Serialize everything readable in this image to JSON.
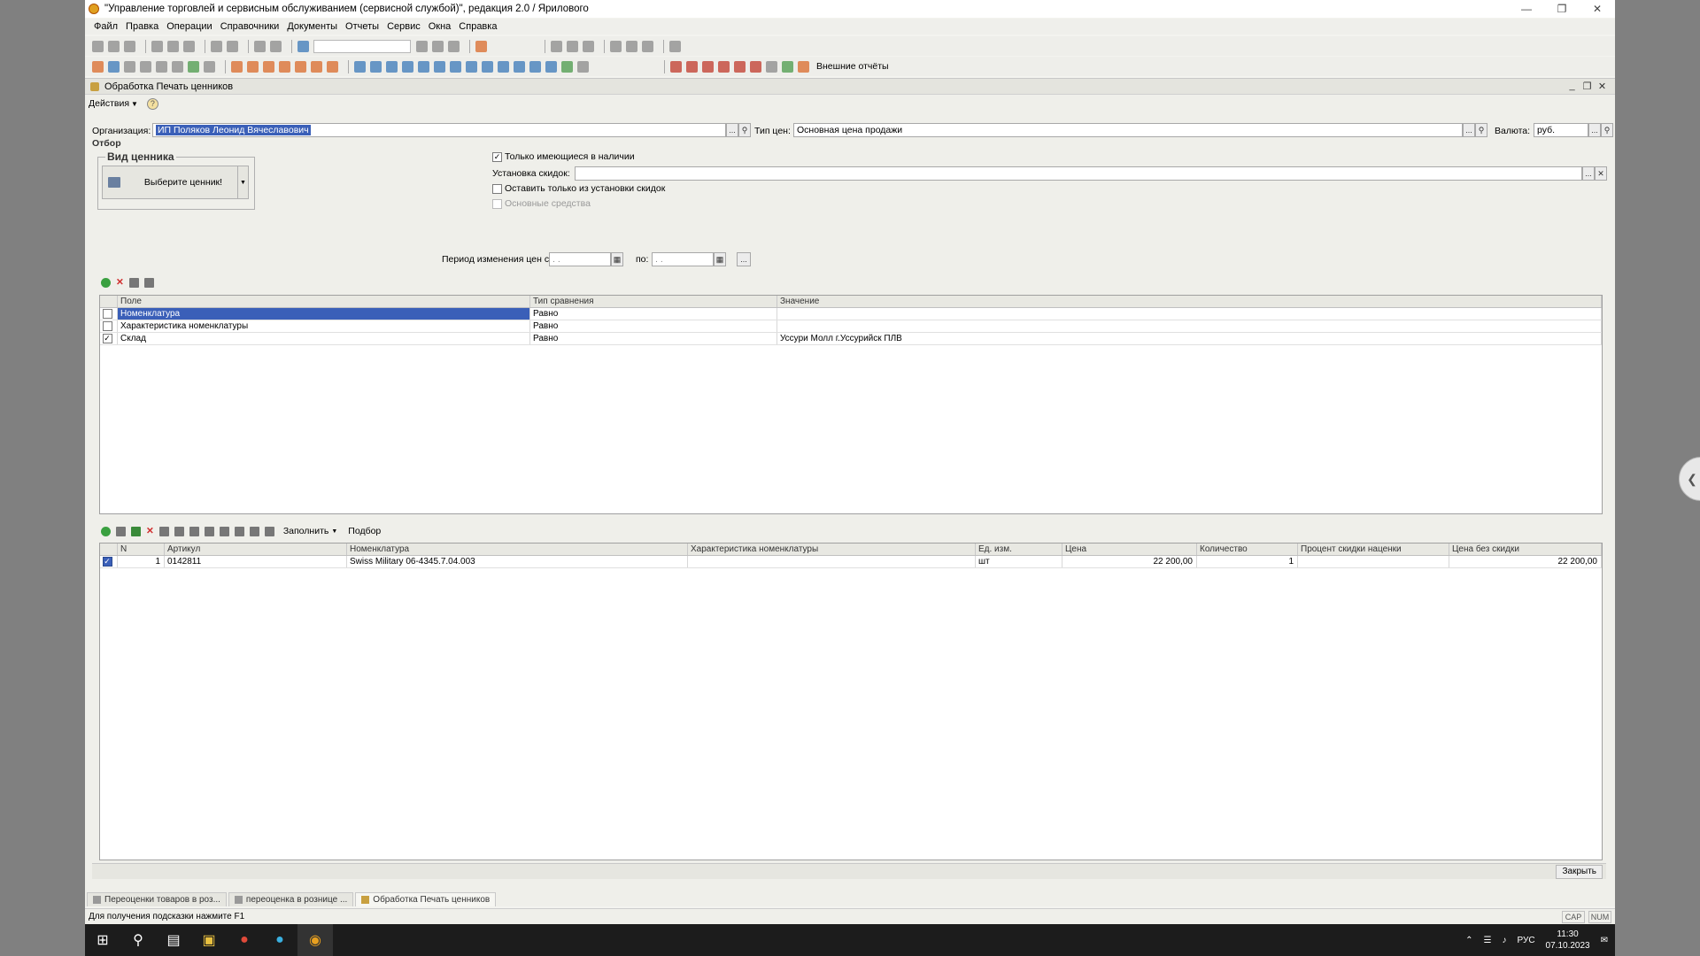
{
  "window": {
    "title": "\"Управление торговлей и сервисным обслуживанием (сервисной службой)\", редакция 2.0 / Ярилового"
  },
  "menu": [
    "Файл",
    "Правка",
    "Операции",
    "Справочники",
    "Документы",
    "Отчеты",
    "Сервис",
    "Окна",
    "Справка"
  ],
  "toolbar": {
    "external_reports": "Внешние отчёты"
  },
  "doc": {
    "title": "Обработка  Печать ценников",
    "actions": "Действия",
    "help": "?"
  },
  "org": {
    "label": "Организация:",
    "value": "ИП Поляков Леонид Вячеславович"
  },
  "price_type": {
    "label": "Тип цен:",
    "value": "Основная цена продажи"
  },
  "currency": {
    "label": "Валюта:",
    "value": "руб."
  },
  "filter_label": "Отбор",
  "tag_kind": {
    "title": "Вид ценника",
    "button": "Выберите ценник!"
  },
  "checks": {
    "in_stock": "Только имеющиеся в наличии",
    "discount_label": "Установка скидок:",
    "only_discount": "Оставить только из установки скидок",
    "fixed_assets": "Основные средства"
  },
  "period": {
    "label": "Период изменения цен с:",
    "from": " . . ",
    "to_label": "по:",
    "to": " . . "
  },
  "filter_grid": {
    "headers": [
      "Поле",
      "Тип сравнения",
      "Значение"
    ],
    "rows": [
      {
        "field": "Номенклатура",
        "cmp": "Равно",
        "value": "",
        "checked": false
      },
      {
        "field": "Характеристика номенклатуры",
        "cmp": "Равно",
        "value": "",
        "checked": false
      },
      {
        "field": "Склад",
        "cmp": "Равно",
        "value": "Уссури Молл  г.Уссурийск ПЛВ",
        "checked": true
      }
    ]
  },
  "items_toolbar": {
    "fill": "Заполнить",
    "pick": "Подбор"
  },
  "items_grid": {
    "headers": [
      "N",
      "Артикул",
      "Номенклатура",
      "Характеристика номенклатуры",
      "Ед. изм.",
      "Цена",
      "Количество",
      "Процент скидки наценки",
      "Цена без скидки"
    ],
    "rows": [
      {
        "n": "1",
        "sku": "0142811",
        "name": "Swiss Military  06-4345.7.04.003",
        "char": "",
        "unit": "шт",
        "price": "22 200,00",
        "qty": "1",
        "pct": "",
        "price_nd": "22 200,00",
        "checked": true
      }
    ]
  },
  "close_button": "Закрыть",
  "window_tabs": [
    "Переоценки товаров в роз...",
    "переоценка в рознице ...",
    "Обработка  Печать ценников"
  ],
  "status": {
    "hint": "Для получения подсказки нажмите F1",
    "cap": "CAP",
    "num": "NUM"
  },
  "taskbar": {
    "lang": "РУС",
    "time": "11:30",
    "date": "07.10.2023"
  }
}
